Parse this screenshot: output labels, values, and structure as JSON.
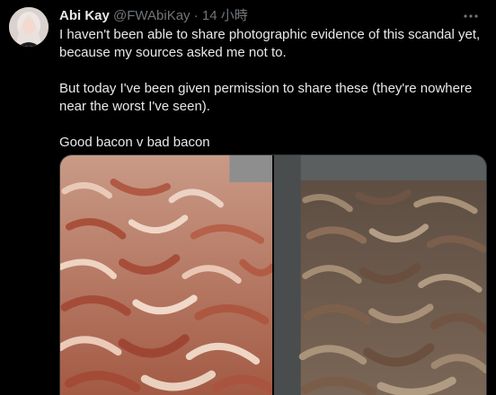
{
  "author": {
    "display_name": "Abi Kay",
    "handle": "@FWAbiKay",
    "separator": "·",
    "time": "14 小時"
  },
  "tweet": {
    "paragraphs": [
      "I haven't been able to share photographic evidence of this scandal yet, because my sources asked me not to.",
      "But today I've been given permission to share these (they're nowhere near the worst I've seen).",
      "Good bacon v bad bacon"
    ]
  },
  "media": {
    "images": [
      {
        "name": "good-bacon-photo",
        "dominant_color": "#b9705a"
      },
      {
        "name": "bad-bacon-photo",
        "dominant_color": "#6b5a4c"
      }
    ]
  },
  "icons": {
    "avatar": "avatar-photo",
    "more": "more-horizontal-icon"
  },
  "colors": {
    "background": "#000000",
    "text_primary": "#e7e9ea",
    "text_secondary": "#71767b"
  }
}
